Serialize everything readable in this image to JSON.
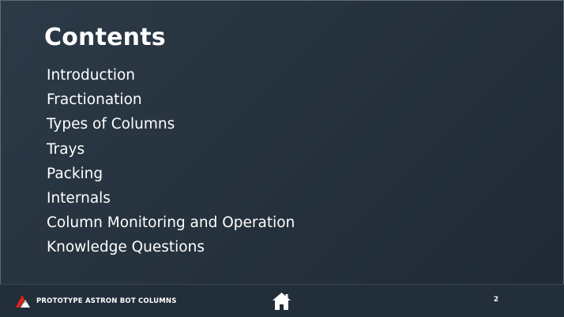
{
  "slide": {
    "title": "Contents",
    "items": [
      "Introduction",
      "Fractionation",
      "Types of Columns",
      "Trays",
      "Packing",
      "Internals",
      "Column Monitoring and Operation",
      "Knowledge Questions"
    ]
  },
  "footer": {
    "brand_text": "PROTOTYPE ASTRON BOT COLUMNS",
    "brand_logo_icon": "astron-logo-icon",
    "home_icon": "home-icon",
    "page_number": "2"
  },
  "colors": {
    "background": "#26323e",
    "footer_background": "#222e39",
    "text": "#ffffff",
    "logo_red": "#e2231a"
  }
}
